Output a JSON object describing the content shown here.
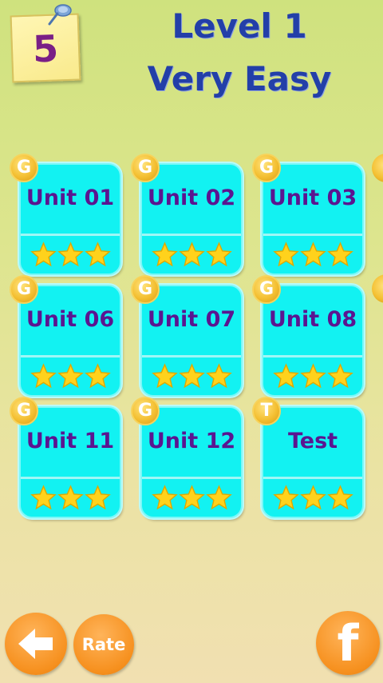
{
  "header": {
    "level_number": "5",
    "title_line1": "Level 1",
    "title_line2": "Very Easy"
  },
  "units": [
    {
      "label": "Unit 01",
      "badge": "G",
      "stars": 3
    },
    {
      "label": "Unit 02",
      "badge": "G",
      "stars": 3
    },
    {
      "label": "Unit 03",
      "badge": "G",
      "stars": 3
    },
    {
      "label": "Unit 06",
      "badge": "G",
      "stars": 3
    },
    {
      "label": "Unit 07",
      "badge": "G",
      "stars": 3
    },
    {
      "label": "Unit 08",
      "badge": "G",
      "stars": 3
    },
    {
      "label": "Unit 11",
      "badge": "G",
      "stars": 3
    },
    {
      "label": "Unit 12",
      "badge": "G",
      "stars": 3
    },
    {
      "label": "Test",
      "badge": "T",
      "stars": 3
    }
  ],
  "footer": {
    "back_icon": "arrow-left-icon",
    "rate_label": "Rate",
    "facebook_glyph": "f"
  },
  "colors": {
    "card": "#12f2f2",
    "label": "#5b1590",
    "title": "#233fa8",
    "button": "#f6901e",
    "badge": "#f4c033",
    "star": "#ffd21c"
  }
}
